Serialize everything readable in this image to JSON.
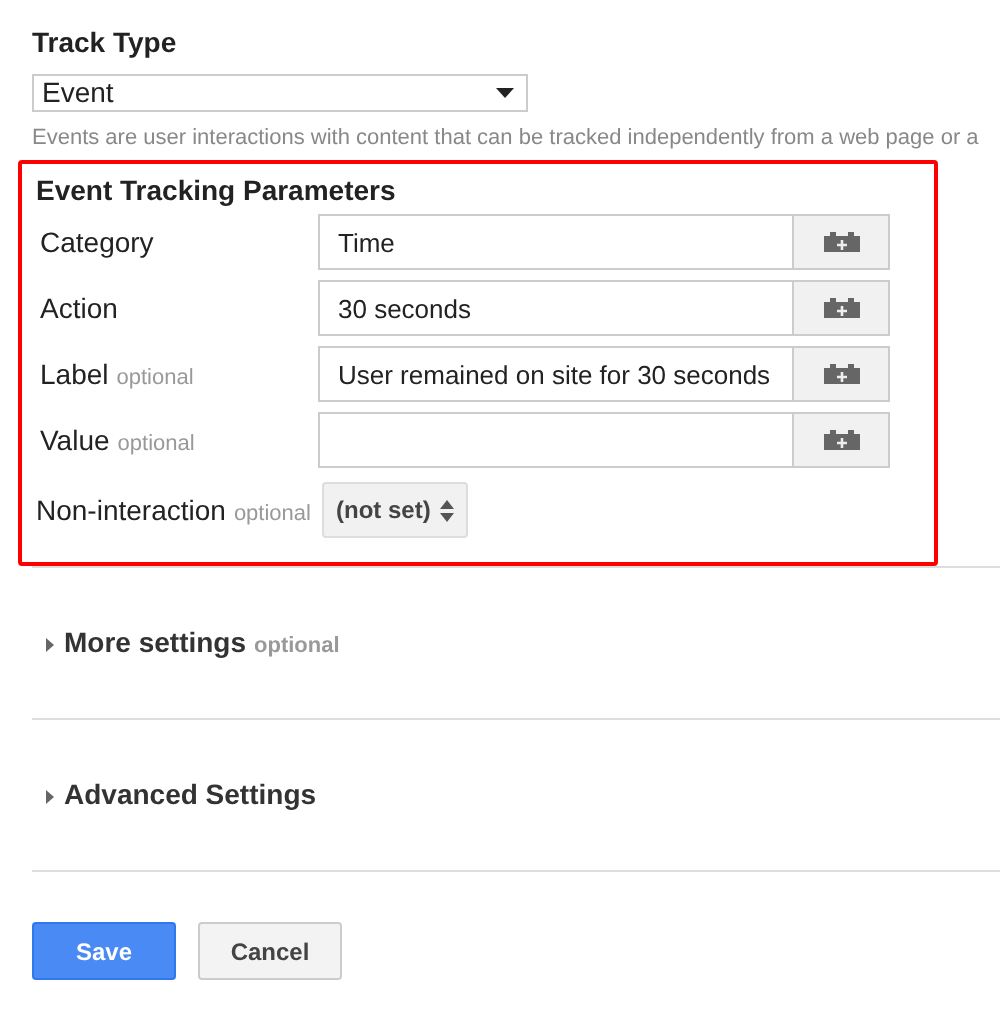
{
  "track_type": {
    "label": "Track Type",
    "value": "Event",
    "help": "Events are user interactions with content that can be tracked independently from a web page or a"
  },
  "parameters": {
    "title": "Event Tracking Parameters",
    "fields": [
      {
        "label": "Category",
        "value": "Time"
      },
      {
        "label": "Action",
        "value": "30 seconds"
      },
      {
        "label": "Label",
        "optional": "optional",
        "value": "User remained on site for 30 seconds"
      },
      {
        "label": "Value",
        "optional": "optional"
      }
    ],
    "non_interaction": {
      "label": "Non-interaction",
      "optional": "optional",
      "value": "(not set)"
    }
  },
  "sections": [
    {
      "title": "More settings",
      "optional": "optional",
      "expanded": false
    },
    {
      "title": "Advanced Settings",
      "expanded": false
    }
  ],
  "buttons": [
    {
      "label": "Save",
      "kind": "primary"
    },
    {
      "label": "Cancel",
      "kind": "secondary"
    }
  ]
}
